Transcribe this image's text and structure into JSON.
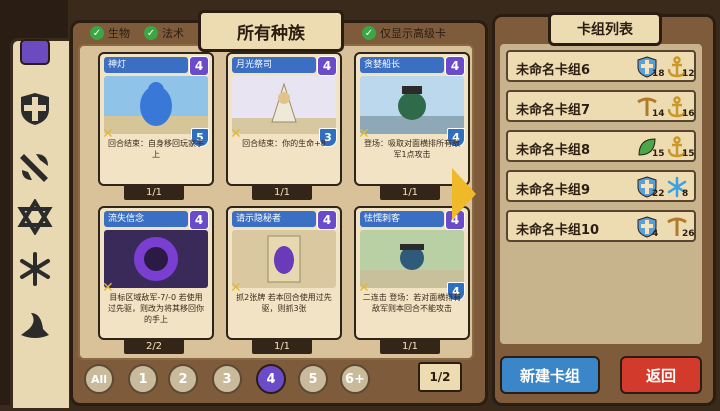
{
  "filters": {
    "creature_label": "生物",
    "spell_label": "法术",
    "advanced_only_label": "仅显示高级卡"
  },
  "title": "所有种族",
  "rail_icons": [
    "faction-purple-icon",
    "shield-cross-icon",
    "axe-icon",
    "star-of-david-icon",
    "snowflake-icon",
    "hat-icon"
  ],
  "cards": [
    {
      "name": "神灯",
      "cost": "4",
      "hp": "5",
      "text": "回合结束：自身移回玩家手上",
      "qty": "1/1",
      "name_bg": "#3a6fc4",
      "art": "genie"
    },
    {
      "name": "月光祭司",
      "cost": "4",
      "hp": "3",
      "text": "回合结束：你的生命+8",
      "qty": "1/1",
      "name_bg": "#3a6fc4",
      "art": "priest"
    },
    {
      "name": "贪婪船长",
      "cost": "4",
      "hp": "4",
      "text": "登场：吸取对面横排所有敌军1点攻击",
      "qty": "1/1",
      "name_bg": "#3a6fc4",
      "art": "captain"
    },
    {
      "name": "流失信念",
      "cost": "4",
      "hp": "",
      "text": "目标区域敌军-7/-0 若使用过先驱，则改为将其移回你的手上",
      "qty": "2/2",
      "name_bg": "#3a6fc4",
      "art": "vortex"
    },
    {
      "name": "请示隐秘者",
      "cost": "4",
      "hp": "",
      "text": "抓2张牌 若本回合使用过先驱，则抓3张",
      "qty": "1/1",
      "name_bg": "#3a6fc4",
      "art": "hooded"
    },
    {
      "name": "怯懦刺客",
      "cost": "4",
      "hp": "4",
      "text": "二连击 登场：若对面横排有敌军则本回合不能攻击",
      "qty": "1/1",
      "name_bg": "#3a6fc4",
      "art": "assassin"
    }
  ],
  "rarity_filters": [
    "All",
    "1",
    "2",
    "3",
    "4",
    "5",
    "6+"
  ],
  "selected_rarity": "4",
  "page": "1/2",
  "deck_list": {
    "title": "卡组列表",
    "decks": [
      {
        "name": "未命名卡组6",
        "icon1": "shield-cross-icon",
        "count1": "18",
        "icon2": "anchor-icon",
        "count2": "12"
      },
      {
        "name": "未命名卡组7",
        "icon1": "crossbow-icon",
        "count1": "14",
        "icon2": "anchor-icon",
        "count2": "16"
      },
      {
        "name": "未命名卡组8",
        "icon1": "leaf-icon",
        "count1": "15",
        "icon2": "anchor-icon",
        "count2": "15"
      },
      {
        "name": "未命名卡组9",
        "icon1": "shield-cross-icon",
        "count1": "22",
        "icon2": "snowflake-icon",
        "count2": "8"
      },
      {
        "name": "未命名卡组10",
        "icon1": "shield-cross-icon",
        "count1": "4",
        "icon2": "crossbow-icon",
        "count2": "26"
      }
    ]
  },
  "buttons": {
    "new_deck": "新建卡组",
    "back": "返回"
  },
  "colors": {
    "new_deck_bg": "#3a86c8",
    "back_bg": "#d23a2c",
    "cost_purple": "#6a4bc9",
    "arrow": "#f0b92a"
  }
}
